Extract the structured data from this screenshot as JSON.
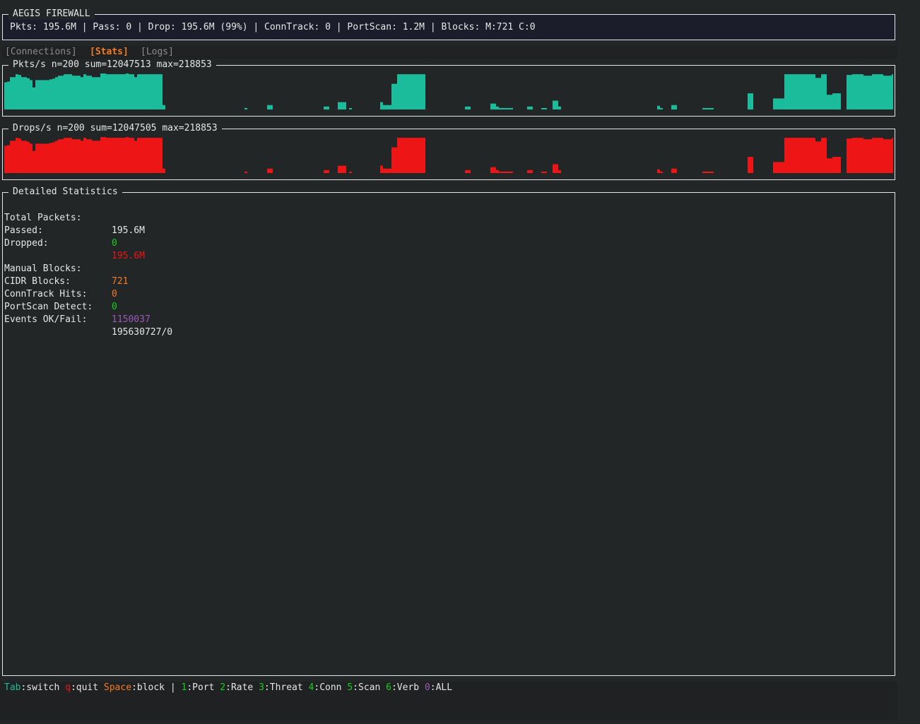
{
  "colors": {
    "pkts": "#1abc9c",
    "drops": "#ed1515",
    "green": "#11d116",
    "red": "#ed1515",
    "orange": "#f47b23",
    "purple": "#9b59b6",
    "accent": "#f47b23"
  },
  "header": {
    "title": "AEGIS FIREWALL",
    "summary": "Pkts: 195.6M | Pass: 0 | Drop: 195.6M (99%) | ConnTrack: 0 | PortScan: 1.2M | Blocks: M:721 C:0"
  },
  "tabs": [
    {
      "label": "[Connections]",
      "active": false
    },
    {
      "label": "[Stats]",
      "active": true
    },
    {
      "label": "[Logs]",
      "active": false
    }
  ],
  "pkts": {
    "title": "Pkts/s n=200 sum=12047513 max=218853",
    "values": [
      0.74,
      0.76,
      0.88,
      0.88,
      0.96,
      0.94,
      0.88,
      0.88,
      0.85,
      0.8,
      0.6,
      0.8,
      0.8,
      0.8,
      0.8,
      0.8,
      0.82,
      0.84,
      0.88,
      0.92,
      0.92,
      0.96,
      0.96,
      0.96,
      0.92,
      0.92,
      0.92,
      0.88,
      0.96,
      0.92,
      0.92,
      0.88,
      0.88,
      0.88,
      0.98,
      0.98,
      0.96,
      0.96,
      0.96,
      0.96,
      0.96,
      0.96,
      0.96,
      0.98,
      0.96,
      0.96,
      0.88,
      0.96,
      0.96,
      0.96,
      0.96,
      0.96,
      0.96,
      0.96,
      0.96,
      0.96,
      0.12,
      0,
      0,
      0,
      0,
      0,
      0,
      0,
      0,
      0,
      0,
      0,
      0,
      0,
      0,
      0,
      0,
      0,
      0,
      0,
      0,
      0,
      0,
      0,
      0,
      0,
      0,
      0,
      0,
      0.04,
      0,
      0,
      0,
      0,
      0,
      0,
      0,
      0.12,
      0.12,
      0,
      0,
      0,
      0,
      0,
      0,
      0,
      0,
      0,
      0,
      0,
      0,
      0,
      0,
      0,
      0,
      0,
      0,
      0.08,
      0.08,
      0,
      0,
      0,
      0.2,
      0.2,
      0.2,
      0,
      0.04,
      0,
      0,
      0,
      0,
      0,
      0,
      0,
      0,
      0,
      0,
      0.2,
      0.12,
      0.12,
      0.12,
      0.7,
      0.7,
      0.96,
      0.96,
      0.96,
      0.96,
      0.96,
      0.96,
      0.96,
      0.96,
      0.96,
      0.96,
      0,
      0,
      0,
      0,
      0,
      0,
      0,
      0,
      0,
      0,
      0,
      0,
      0,
      0,
      0.08,
      0.08,
      0,
      0,
      0,
      0,
      0,
      0,
      0,
      0.16,
      0.16,
      0.08,
      0.04,
      0.04,
      0.04,
      0.04,
      0.04,
      0,
      0,
      0,
      0,
      0,
      0.08,
      0.08,
      0,
      0,
      0,
      0.04,
      0.04,
      0,
      0,
      0.24,
      0.24,
      0.08,
      0,
      0,
      0,
      0,
      0,
      0,
      0,
      0,
      0,
      0,
      0,
      0,
      0,
      0,
      0,
      0,
      0,
      0,
      0,
      0,
      0,
      0,
      0,
      0,
      0,
      0,
      0,
      0,
      0,
      0,
      0,
      0,
      0,
      0,
      0.1,
      0.04,
      0,
      0,
      0,
      0.12,
      0.12,
      0,
      0,
      0,
      0,
      0,
      0,
      0,
      0,
      0,
      0.04,
      0.04,
      0.04,
      0.04,
      0,
      0,
      0,
      0,
      0,
      0,
      0,
      0,
      0,
      0,
      0,
      0,
      0.44,
      0.44,
      0,
      0,
      0,
      0,
      0,
      0,
      0,
      0.3,
      0.3,
      0.3,
      0.3,
      0.96,
      0.96,
      0.96,
      0.96,
      0.96,
      0.96,
      0.96,
      0.96,
      0.96,
      0.96,
      0.96,
      0.86,
      0.86,
      0.96,
      0.96,
      0.4,
      0.4,
      0.44,
      0.44,
      0.44,
      0,
      0,
      0.94,
      0.94,
      0.96,
      0.96,
      0.96,
      0.96,
      0.92,
      0.92,
      0.92,
      0.96,
      0.96,
      0.96,
      0.96,
      0.92,
      0.92,
      0.92,
      0.96,
      0.96,
      0.96,
      0.96,
      0.96,
      0.96,
      0.96,
      0.96,
      0.96,
      0.96,
      0.92,
      0.92,
      0,
      0.04,
      0.04,
      0,
      0
    ]
  },
  "drops": {
    "title": "Drops/s n=200 sum=12047505 max=218853",
    "values": [
      0.74,
      0.76,
      0.88,
      0.88,
      0.96,
      0.94,
      0.88,
      0.88,
      0.85,
      0.8,
      0.6,
      0.8,
      0.8,
      0.8,
      0.8,
      0.8,
      0.82,
      0.84,
      0.88,
      0.92,
      0.92,
      0.96,
      0.96,
      0.96,
      0.92,
      0.92,
      0.92,
      0.88,
      0.96,
      0.92,
      0.92,
      0.88,
      0.88,
      0.88,
      0.98,
      0.98,
      0.96,
      0.96,
      0.96,
      0.96,
      0.96,
      0.96,
      0.96,
      0.98,
      0.96,
      0.96,
      0.88,
      0.96,
      0.96,
      0.96,
      0.96,
      0.96,
      0.96,
      0.96,
      0.96,
      0.96,
      0.12,
      0,
      0,
      0,
      0,
      0,
      0,
      0,
      0,
      0,
      0,
      0,
      0,
      0,
      0,
      0,
      0,
      0,
      0,
      0,
      0,
      0,
      0,
      0,
      0,
      0,
      0,
      0,
      0,
      0.04,
      0,
      0,
      0,
      0,
      0,
      0,
      0,
      0.12,
      0.12,
      0,
      0,
      0,
      0,
      0,
      0,
      0,
      0,
      0,
      0,
      0,
      0,
      0,
      0,
      0,
      0,
      0,
      0,
      0.08,
      0.08,
      0,
      0,
      0,
      0.2,
      0.2,
      0.2,
      0,
      0.04,
      0,
      0,
      0,
      0,
      0,
      0,
      0,
      0,
      0,
      0,
      0.2,
      0.12,
      0.12,
      0.12,
      0.7,
      0.7,
      0.96,
      0.96,
      0.96,
      0.96,
      0.96,
      0.96,
      0.96,
      0.96,
      0.96,
      0.96,
      0,
      0,
      0,
      0,
      0,
      0,
      0,
      0,
      0,
      0,
      0,
      0,
      0,
      0,
      0.08,
      0.08,
      0,
      0,
      0,
      0,
      0,
      0,
      0,
      0.16,
      0.16,
      0.08,
      0.04,
      0.04,
      0.04,
      0.04,
      0.04,
      0,
      0,
      0,
      0,
      0,
      0.08,
      0.08,
      0,
      0,
      0,
      0.04,
      0.04,
      0,
      0,
      0.24,
      0.24,
      0.08,
      0,
      0,
      0,
      0,
      0,
      0,
      0,
      0,
      0,
      0,
      0,
      0,
      0,
      0,
      0,
      0,
      0,
      0,
      0,
      0,
      0,
      0,
      0,
      0,
      0,
      0,
      0,
      0,
      0,
      0,
      0,
      0,
      0,
      0,
      0.1,
      0.04,
      0,
      0,
      0,
      0.12,
      0.12,
      0,
      0,
      0,
      0,
      0,
      0,
      0,
      0,
      0,
      0.04,
      0.04,
      0.04,
      0.04,
      0,
      0,
      0,
      0,
      0,
      0,
      0,
      0,
      0,
      0,
      0,
      0,
      0.44,
      0.44,
      0,
      0,
      0,
      0,
      0,
      0,
      0,
      0.3,
      0.3,
      0.3,
      0.3,
      0.96,
      0.96,
      0.96,
      0.96,
      0.96,
      0.96,
      0.96,
      0.96,
      0.96,
      0.96,
      0.96,
      0.86,
      0.86,
      0.96,
      0.96,
      0.4,
      0.4,
      0.44,
      0.44,
      0.44,
      0,
      0,
      0.94,
      0.94,
      0.96,
      0.96,
      0.96,
      0.96,
      0.92,
      0.92,
      0.92,
      0.96,
      0.96,
      0.96,
      0.96,
      0.92,
      0.92,
      0.92,
      0.96,
      0.96,
      0.96,
      0.96,
      0.96,
      0.96,
      0.96,
      0.96,
      0.96,
      0.96,
      0.92,
      0.92,
      0,
      0.04,
      0.04,
      0,
      0
    ]
  },
  "stats": {
    "title": "Detailed Statistics",
    "rows": [
      {
        "label": "Total Packets:",
        "value": "195.6M",
        "color": "#e6e6e6"
      },
      {
        "label": "Passed:",
        "value": "0",
        "color": "#11d116"
      },
      {
        "label": "Dropped:",
        "value": "195.6M",
        "color": "#ed1515"
      },
      {
        "label": "",
        "value": "",
        "color": "#e6e6e6"
      },
      {
        "label": "Manual Blocks:",
        "value": "721",
        "color": "#f47b23"
      },
      {
        "label": "CIDR Blocks:",
        "value": "0",
        "color": "#f47b23"
      },
      {
        "label": "ConnTrack Hits:",
        "value": "0",
        "color": "#11d116"
      },
      {
        "label": "PortScan Detect:",
        "value": "1150037",
        "color": "#9b59b6"
      },
      {
        "label": "Events OK/Fail:",
        "value": "195630727/0",
        "color": "#e6e6e6"
      }
    ]
  },
  "footer": {
    "k1": "Tab",
    "d1": ":switch ",
    "k2": "q",
    "d2": ":quit ",
    "k3": "Space",
    "d3": ":block | ",
    "k4": "1",
    "d4": ":Port ",
    "k5": "2",
    "d5": ":Rate ",
    "k6": "3",
    "d6": ":Threat ",
    "k7": "4",
    "d7": ":Conn ",
    "k8": "5",
    "d8": ":Scan ",
    "k9": "6",
    "d9": ":Verb ",
    "k10": "0",
    "d10": ":ALL"
  }
}
